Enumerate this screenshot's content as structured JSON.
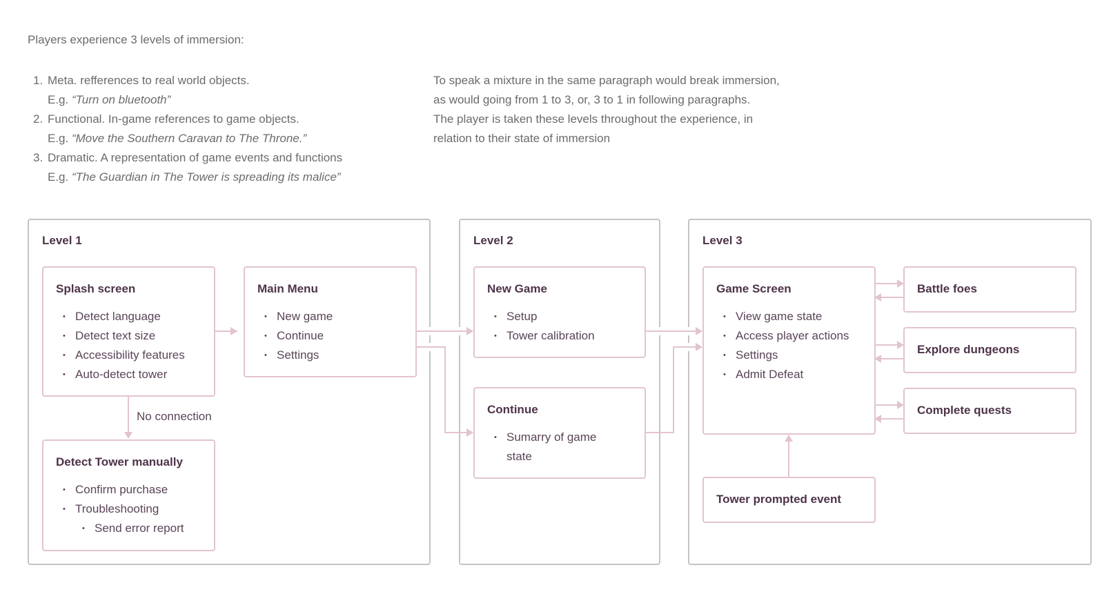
{
  "intro": "Players experience 3 levels of immersion:",
  "levels_list": [
    {
      "num": "1.",
      "text": "Meta. refferences to real world objects.",
      "example_prefix": "E.g. ",
      "example": "“Turn on bluetooth”"
    },
    {
      "num": "2.",
      "text": "Functional. In-game references to game objects.",
      "example_prefix": "E.g. ",
      "example": "“Move the Southern Caravan to The Throne.”"
    },
    {
      "num": "3.",
      "text": "Dramatic. A representation of game events and functions",
      "example_prefix": "E.g. ",
      "example": "“The Guardian in The Tower is spreading its malice”"
    }
  ],
  "paragraph": {
    "line1": "To speak a mixture in the same paragraph would break immersion, as would going from 1 to 3, or, 3 to 1 in following paragraphs.",
    "line2": "The player is taken these levels throughout the experience, in relation to their state of immersion"
  },
  "colors": {
    "node_border": "#e2c4cf",
    "level_border": "#c4c4c4",
    "title": "#4e3349",
    "arrow": "#e2c4cf"
  },
  "diagram": {
    "level1": {
      "title": "Level 1",
      "splash": {
        "title": "Splash screen",
        "items": [
          "Detect language",
          "Detect text size",
          "Accessibility features",
          "Auto-detect tower"
        ]
      },
      "main_menu": {
        "title": "Main Menu",
        "items": [
          "New game",
          "Continue",
          "Settings"
        ]
      },
      "detect_manual": {
        "title": "Detect Tower manually",
        "items": [
          "Confirm purchase",
          "Troubleshooting"
        ],
        "sub_items": [
          "Send error report"
        ]
      },
      "edge_label": "No connection"
    },
    "level2": {
      "title": "Level 2",
      "new_game": {
        "title": "New Game",
        "items": [
          "Setup",
          "Tower calibration"
        ]
      },
      "continue": {
        "title": "Continue",
        "items": [
          "Sumarry of game state"
        ]
      }
    },
    "level3": {
      "title": "Level 3",
      "game_screen": {
        "title": "Game Screen",
        "items": [
          "View game state",
          "Access player actions",
          "Settings",
          "Admit Defeat"
        ]
      },
      "battle": {
        "title": "Battle foes"
      },
      "explore": {
        "title": "Explore dungeons"
      },
      "quests": {
        "title": "Complete quests"
      },
      "tower_event": {
        "title": "Tower prompted event"
      }
    }
  }
}
